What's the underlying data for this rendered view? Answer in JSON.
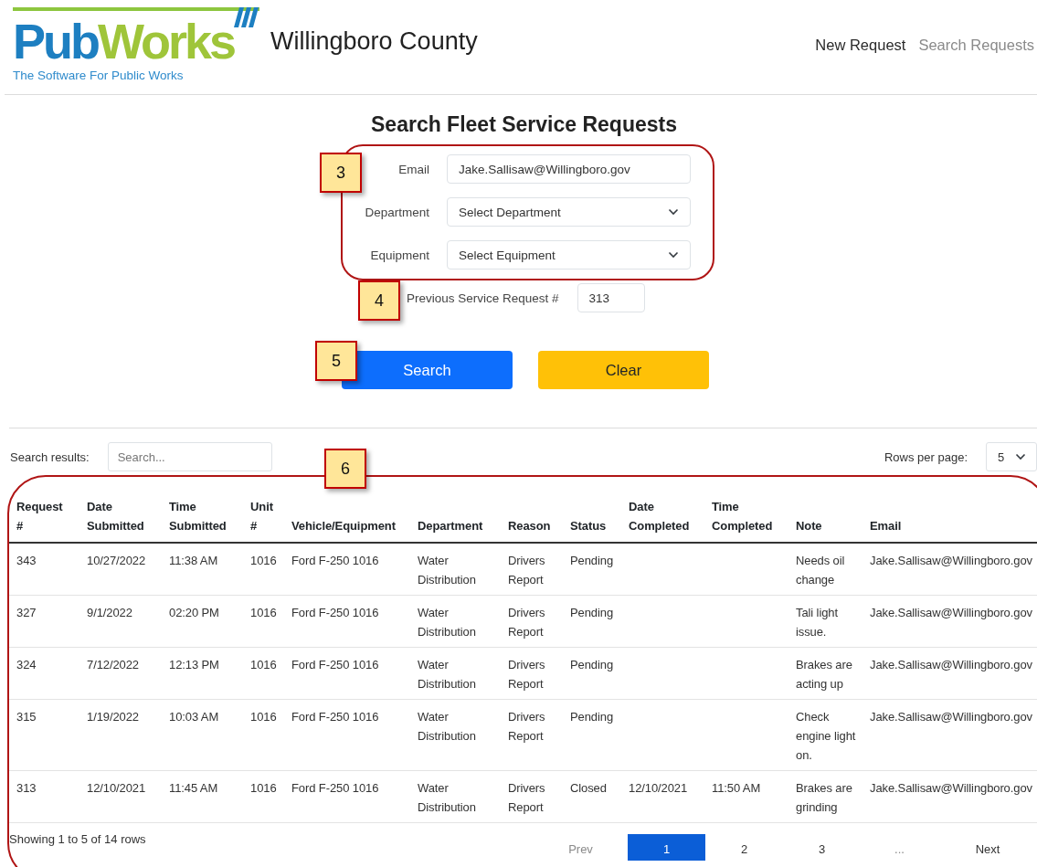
{
  "header": {
    "logo": {
      "word_1": "Pub",
      "word_2": "Works",
      "tagline": "The Software For Public Works"
    },
    "title": "Willingboro County",
    "nav": [
      {
        "label": "New Request",
        "selected": true
      },
      {
        "label": "Search Requests",
        "selected": false
      }
    ]
  },
  "page_title": "Search Fleet Service Requests",
  "form": {
    "fields": [
      {
        "kind": "input",
        "label": "Email",
        "value": "Jake.Sallisaw@Willingboro.gov"
      },
      {
        "kind": "select",
        "label": "Department",
        "value": "Select Department"
      },
      {
        "kind": "select",
        "label": "Equipment",
        "value": "Select Equipment"
      }
    ],
    "previous_request": {
      "label": "Previous Service Request #",
      "value": "313"
    },
    "buttons": [
      {
        "kind": "primary",
        "label": "Search"
      },
      {
        "kind": "warning",
        "label": "Clear"
      }
    ]
  },
  "results": {
    "search_label": "Search results:",
    "search_placeholder": "Search...",
    "rows_per_page_label": "Rows per page:",
    "rows_per_page": "5",
    "columns": [
      "Request #",
      "Date Submitted",
      "Time Submitted",
      "Unit #",
      "Vehicle/Equipment",
      "Department",
      "Reason",
      "Status",
      "Date Completed",
      "Time Completed",
      "Note",
      "Email"
    ],
    "rows": [
      [
        "343",
        "10/27/2022",
        "11:38 AM",
        "1016",
        "Ford F-250 1016",
        "Water Distribution",
        "Drivers Report",
        "Pending",
        "",
        "",
        "Needs oil change",
        "Jake.Sallisaw@Willingboro.gov"
      ],
      [
        "327",
        "9/1/2022",
        "02:20 PM",
        "1016",
        "Ford F-250 1016",
        "Water Distribution",
        "Drivers Report",
        "Pending",
        "",
        "",
        "Tali light issue.",
        "Jake.Sallisaw@Willingboro.gov"
      ],
      [
        "324",
        "7/12/2022",
        "12:13 PM",
        "1016",
        "Ford F-250 1016",
        "Water Distribution",
        "Drivers Report",
        "Pending",
        "",
        "",
        "Brakes are acting up",
        "Jake.Sallisaw@Willingboro.gov"
      ],
      [
        "315",
        "1/19/2022",
        "10:03 AM",
        "1016",
        "Ford F-250 1016",
        "Water Distribution",
        "Drivers Report",
        "Pending",
        "",
        "",
        "Check engine light on.",
        "Jake.Sallisaw@Willingboro.gov"
      ],
      [
        "313",
        "12/10/2021",
        "11:45 AM",
        "1016",
        "Ford F-250 1016",
        "Water Distribution",
        "Drivers Report",
        "Closed",
        "12/10/2021",
        "11:50 AM",
        "Brakes are grinding",
        "Jake.Sallisaw@Willingboro.gov"
      ]
    ],
    "summary": "Showing 1 to 5 of 14 rows",
    "pagination": [
      {
        "label": "Prev",
        "selected": false,
        "disabled": true
      },
      {
        "label": "1",
        "selected": true,
        "disabled": false
      },
      {
        "label": "2",
        "selected": false,
        "disabled": false
      },
      {
        "label": "3",
        "selected": false,
        "disabled": false
      },
      {
        "label": "...",
        "selected": false,
        "disabled": true
      },
      {
        "label": "Next",
        "selected": false,
        "disabled": false
      }
    ]
  },
  "annotations": [
    {
      "label": "3",
      "outlined": true
    },
    {
      "label": "4",
      "outlined": false
    },
    {
      "label": "5",
      "outlined": false
    },
    {
      "label": "6",
      "outlined": true
    }
  ]
}
